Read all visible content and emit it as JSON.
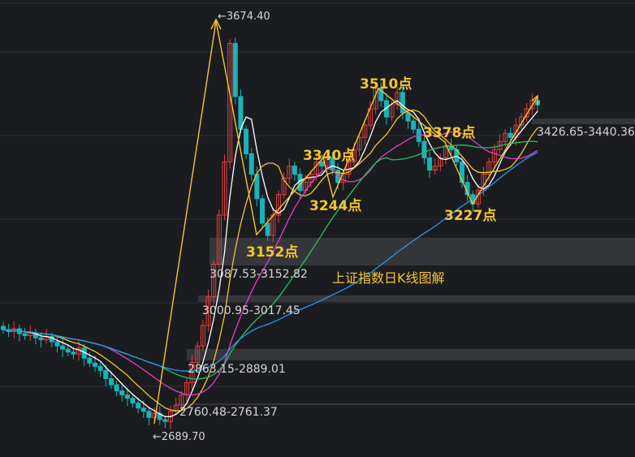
{
  "chart_data": {
    "type": "candlestick",
    "title": "上证指数日K线图解",
    "extremes": [
      {
        "label": "←3674.40",
        "value": 3674.4
      },
      {
        "label": "←2689.70",
        "value": 2689.7
      }
    ],
    "gap_zones": [
      {
        "label": "3426.65-3440.36",
        "low": 3426.65,
        "high": 3440.36
      },
      {
        "label": "3087.53-3152.82",
        "low": 3087.53,
        "high": 3152.82
      },
      {
        "label": "3000.95-3017.45",
        "low": 3000.95,
        "high": 3017.45
      },
      {
        "label": "2863.15-2889.01",
        "low": 2863.15,
        "high": 2889.01
      },
      {
        "label": "2760.48-2761.37",
        "low": 2760.48,
        "high": 2761.37
      }
    ],
    "annotations": [
      {
        "label": "3510点",
        "value": 3510
      },
      {
        "label": "3378点",
        "value": 3378
      },
      {
        "label": "3340点",
        "value": 3340
      },
      {
        "label": "3244点",
        "value": 3244
      },
      {
        "label": "3227点",
        "value": 3227
      },
      {
        "label": "3152点",
        "value": 3152
      }
    ],
    "wave_path": [
      3674.4,
      3152,
      3340,
      3244,
      3510,
      3378,
      3227,
      3490
    ],
    "colors": {
      "up": "#e0413e",
      "down": "#1ab3b8",
      "ma5": "#ffffff",
      "ma10": "#f4c430",
      "ma20": "#e040c8",
      "ma30": "#27c060",
      "ma60": "#2a98e8",
      "wave": "#f4c430"
    }
  }
}
